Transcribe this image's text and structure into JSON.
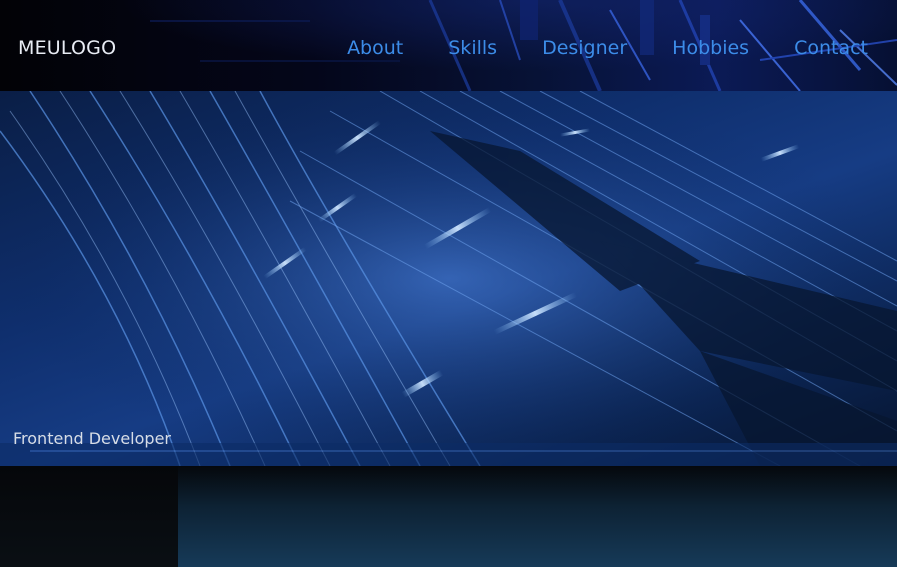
{
  "header": {
    "logo": "MEULOGO",
    "nav": [
      {
        "label": "About"
      },
      {
        "label": "Skills"
      },
      {
        "label": "Designer"
      },
      {
        "label": "Hobbies"
      },
      {
        "label": "Contact"
      }
    ]
  },
  "hero": {
    "caption": "Frontend Developer"
  },
  "colors": {
    "nav_link": "#3c8ce8",
    "logo": "#e8ecf4",
    "caption": "#d7dde6",
    "accent_glow": "#8ec8ff"
  }
}
